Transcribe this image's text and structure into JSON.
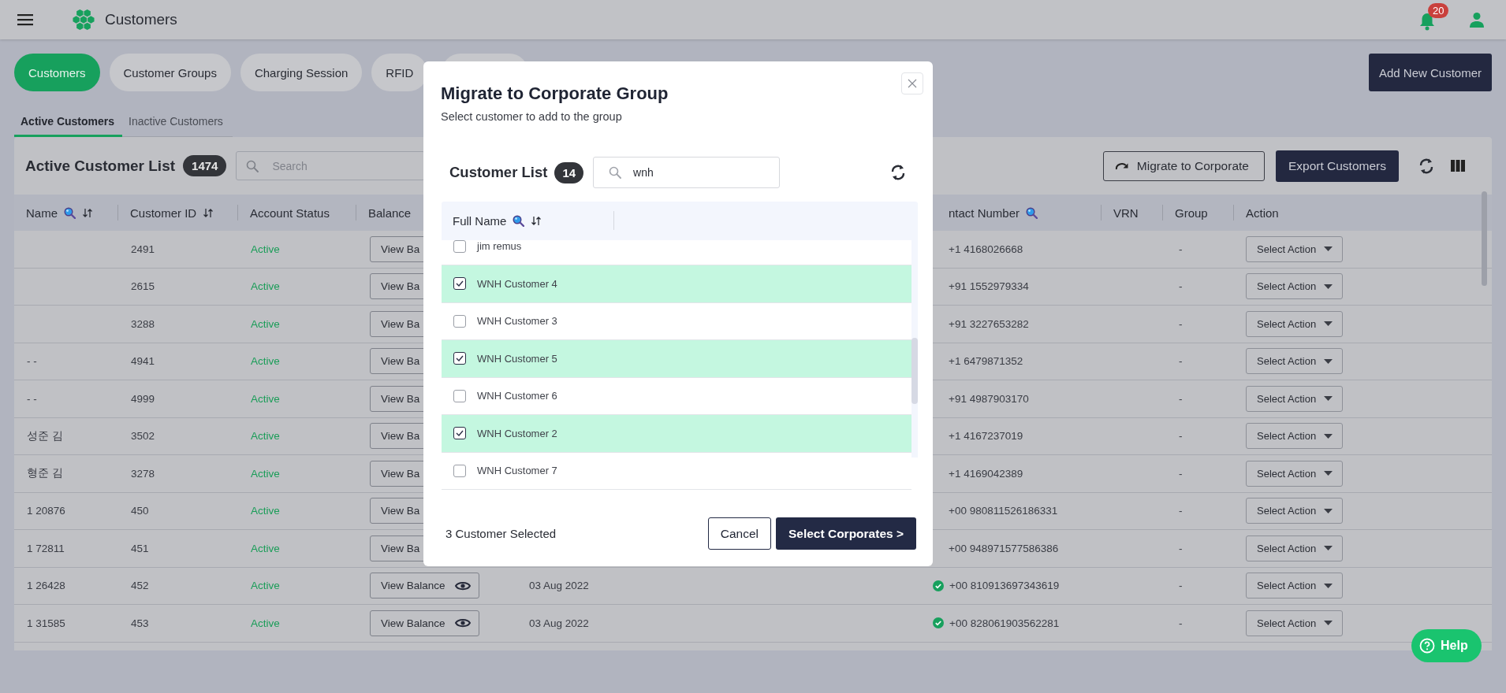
{
  "app_bar": {
    "title": "Customers",
    "notification_count": "20"
  },
  "tabs": [
    {
      "label": "Customers",
      "selected": true
    },
    {
      "label": "Customer Groups",
      "selected": false
    },
    {
      "label": "Charging Session",
      "selected": false
    },
    {
      "label": "RFID",
      "selected": false
    },
    {
      "selected": false
    }
  ],
  "add_button": "Add New Customer",
  "subtabs": [
    {
      "label": "Active Customers",
      "selected": true
    },
    {
      "label": "Inactive Customers",
      "selected": false
    }
  ],
  "list": {
    "title": "Active Customer List",
    "count": "1474",
    "search_placeholder": "Search",
    "migrate_button": "Migrate to Corporate",
    "export_button": "Export Customers"
  },
  "table": {
    "columns": [
      {
        "label": "Name",
        "search": true,
        "sort": true
      },
      {
        "label": "Customer ID",
        "sort": true
      },
      {
        "label": "Account Status"
      },
      {
        "label": "Balance"
      },
      {},
      {
        "label": "ntact Number",
        "search": true
      },
      {
        "label": "VRN"
      },
      {
        "label": "Group"
      },
      {
        "label": "Action"
      }
    ],
    "rows": [
      {
        "id": "2491",
        "status": "Active",
        "active": true,
        "balance": "View Ba",
        "contact": "+1 4168026668",
        "group": "-",
        "action": "Select Action"
      },
      {
        "id": "2615",
        "status": "Active",
        "active": true,
        "balance": "View Ba",
        "contact": "+91 1552979334",
        "group": "-",
        "action": "Select Action"
      },
      {
        "id": "3288",
        "status": "Active",
        "active": true,
        "balance": "View Ba",
        "contact": "+91 3227653282",
        "group": "-",
        "action": "Select Action"
      },
      {
        "name": "- -",
        "id": "4941",
        "status": "Active",
        "active": true,
        "balance": "View Ba",
        "contact": "+1 6479871352",
        "group": "-",
        "action": "Select Action"
      },
      {
        "name": "- -",
        "id": "4999",
        "status": "Active",
        "active": true,
        "balance": "View Ba",
        "contact": "+91 4987903170",
        "group": "-",
        "action": "Select Action"
      },
      {
        "name": "성준 김",
        "id": "3502",
        "status": "Active",
        "active": true,
        "balance": "View Ba",
        "contact": "+1 4167237019",
        "group": "-",
        "action": "Select Action"
      },
      {
        "name": "형준 김",
        "id": "3278",
        "status": "Active",
        "active": true,
        "balance": "View Ba",
        "contact": "+1 4169042389",
        "group": "-",
        "action": "Select Action"
      },
      {
        "name": "1 20876",
        "id": "450",
        "status": "Active",
        "active": true,
        "balance": "View Ba",
        "contact": "+00 980811526186331",
        "group": "-",
        "action": "Select Action"
      },
      {
        "name": "1 72811",
        "id": "451",
        "status": "Active",
        "active": true,
        "balance": "View Ba",
        "contact": "+00 948971577586386",
        "group": "-",
        "action": "Select Action"
      },
      {
        "name": "1 26428",
        "id": "452",
        "status": "Active",
        "active": true,
        "balance": "View Balance",
        "show_icon": true,
        "date": "03 Aug 2022",
        "verified": true,
        "contact": "+00 810913697343619",
        "group": "-",
        "action": "Select Action"
      },
      {
        "name": "1 31585",
        "id": "453",
        "status": "Active",
        "active": true,
        "balance": "View Balance",
        "show_icon": true,
        "date": "03 Aug 2022",
        "verified": true,
        "contact": "+00 828061903562281",
        "group": "-",
        "action": "Select Action"
      }
    ]
  },
  "modal": {
    "title": "Migrate to Corporate Group",
    "subtitle": "Select customer to add to the group",
    "list_title": "Customer List",
    "count": "14",
    "search_value": "wnh",
    "column": "Full Name",
    "customers": [
      {
        "name": "jim remus",
        "checked": false
      },
      {
        "name": "WNH Customer 4",
        "checked": true
      },
      {
        "name": "WNH Customer 3",
        "checked": false
      },
      {
        "name": "WNH Customer 5",
        "checked": true
      },
      {
        "name": "WNH Customer 6",
        "checked": false
      },
      {
        "name": "WNH Customer 2",
        "checked": true
      },
      {
        "name": "WNH Customer 7",
        "checked": false
      }
    ],
    "selected_text": "3 Customer Selected",
    "cancel": "Cancel",
    "confirm": "Select Corporates >"
  },
  "help_button": "Help"
}
